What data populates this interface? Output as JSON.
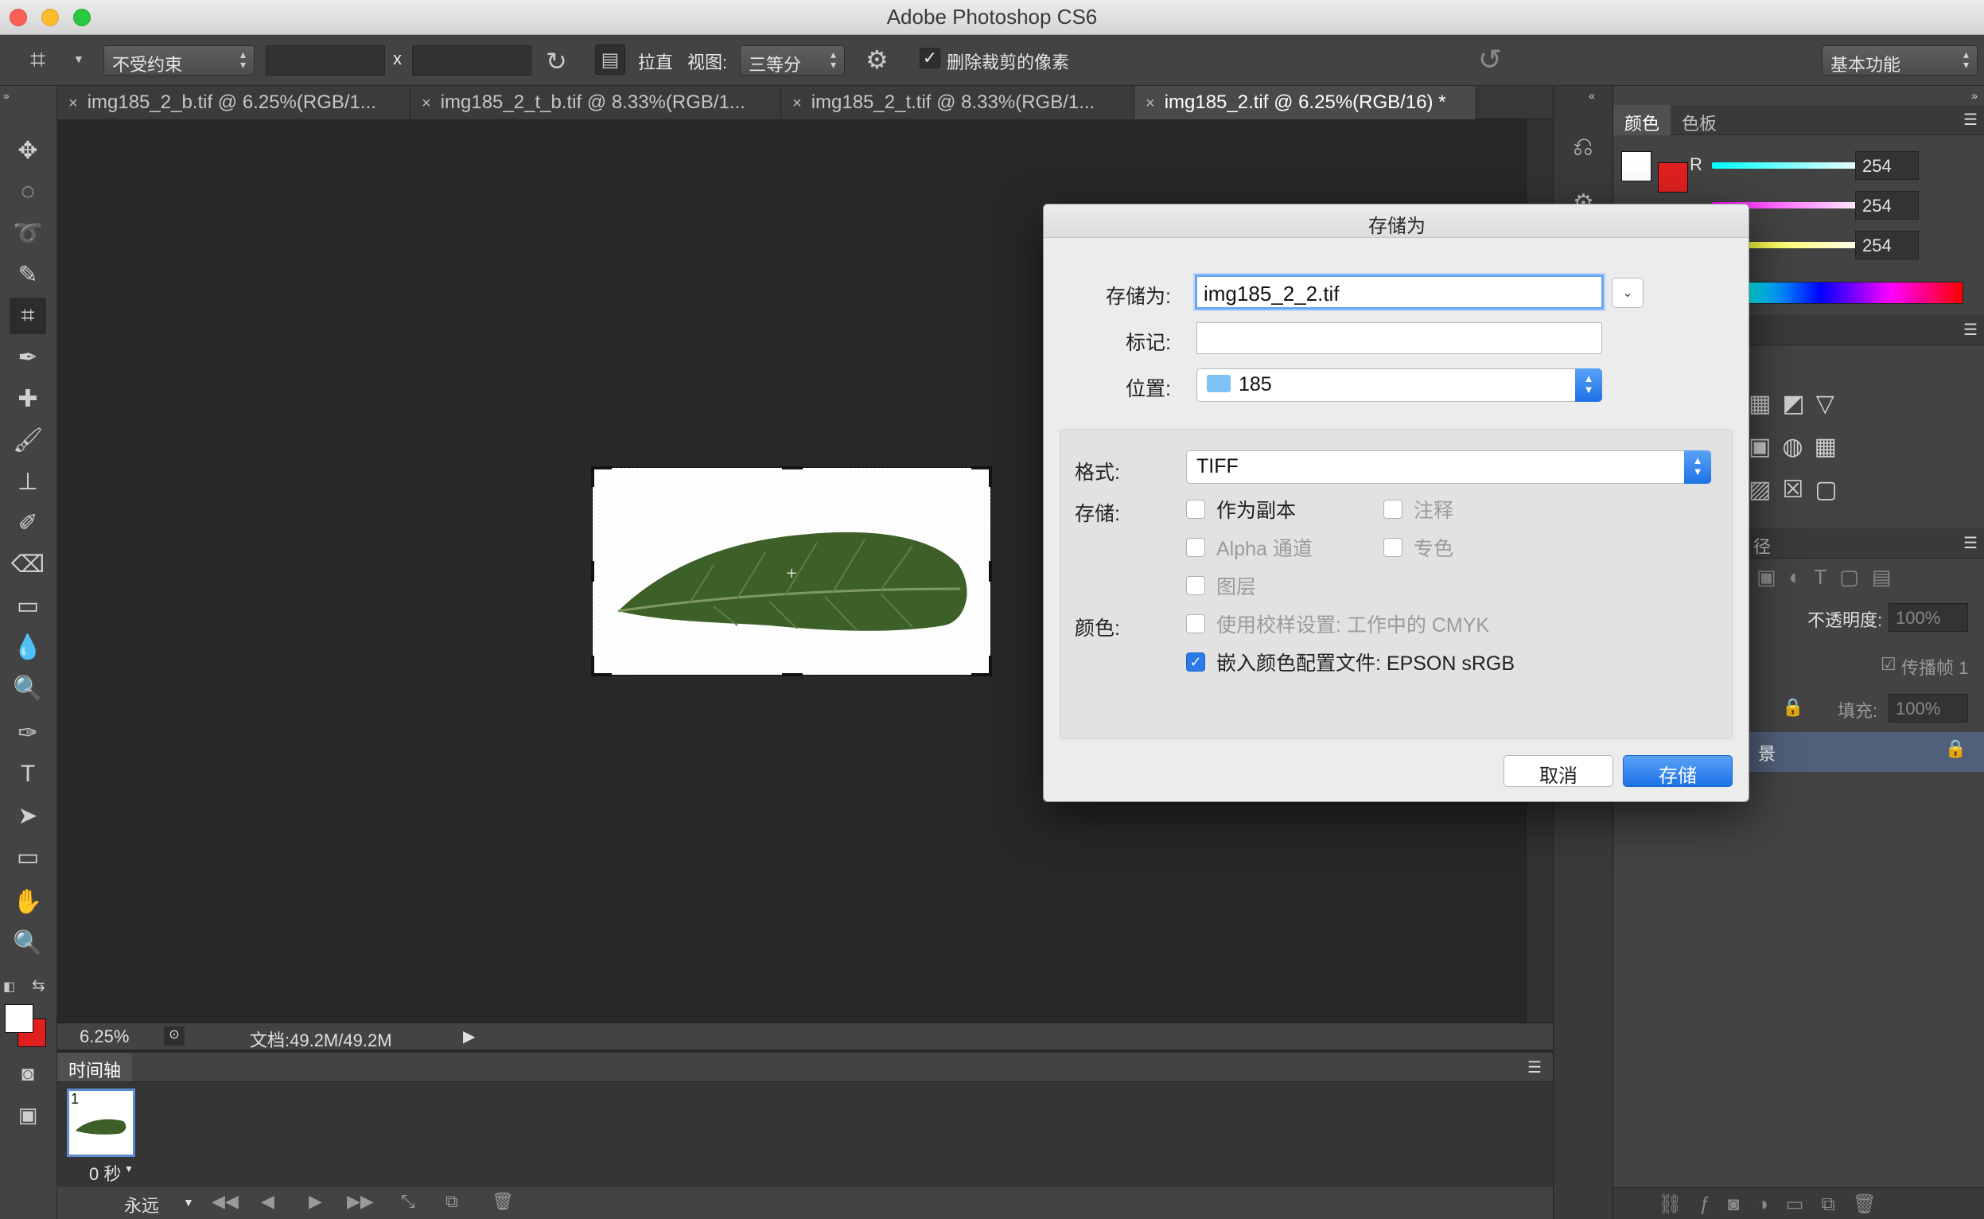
{
  "window": {
    "title": "Adobe Photoshop CS6"
  },
  "options_bar": {
    "ratio_select": "不受约束",
    "x_sep": "x",
    "straighten_label": "拉直",
    "view_label": "视图:",
    "view_select": "三等分",
    "delete_cropped_label": "删除裁剪的像素",
    "delete_cropped_checked": true,
    "workspace_select": "基本功能"
  },
  "tabs": [
    {
      "label": "img185_2_b.tif @ 6.25%(RGB/1...",
      "active": false
    },
    {
      "label": "img185_2_t_b.tif @ 8.33%(RGB/1...",
      "active": false
    },
    {
      "label": "img185_2_t.tif @ 8.33%(RGB/1...",
      "active": false
    },
    {
      "label": "img185_2.tif @ 6.25%(RGB/16) *",
      "active": true
    }
  ],
  "tab_close": "×",
  "status_bar": {
    "zoom": "6.25%",
    "doc_info": "文档:49.2M/49.2M"
  },
  "timeline": {
    "title": "时间轴",
    "frame_number": "1",
    "frame_delay": "0 秒",
    "loop": "永远"
  },
  "color_panel": {
    "tabs": [
      "颜色",
      "色板"
    ],
    "r_label": "R",
    "r": "254",
    "g": "254",
    "b": "254"
  },
  "layers_panel": {
    "tab_fragment": "径",
    "opacity_label": "不透明度:",
    "opacity": "100%",
    "propagate_label": "传播帧 1",
    "fill_label": "填充:",
    "fill": "100%",
    "layer_name_fragment": "景"
  },
  "dialog": {
    "title": "存储为",
    "save_as_label": "存储为:",
    "filename": "img185_2_2.tif",
    "tags_label": "标记:",
    "tags_value": "",
    "location_label": "位置:",
    "location": "185",
    "format_label": "格式:",
    "format": "TIFF",
    "save_label": "存储:",
    "color_label": "颜色:",
    "options": {
      "as_copy": {
        "label": "作为副本",
        "checked": false,
        "enabled": true
      },
      "notes": {
        "label": "注释",
        "checked": false,
        "enabled": false
      },
      "alpha": {
        "label": "Alpha 通道",
        "checked": false,
        "enabled": false
      },
      "spot": {
        "label": "专色",
        "checked": false,
        "enabled": false
      },
      "layers": {
        "label": "图层",
        "checked": false,
        "enabled": false
      },
      "proof": {
        "label": "使用校样设置: 工作中的 CMYK",
        "checked": false,
        "enabled": false
      },
      "icc": {
        "label": "嵌入颜色配置文件: EPSON  sRGB",
        "checked": true,
        "enabled": true
      }
    },
    "cancel": "取消",
    "save": "存储"
  },
  "colors": {
    "accent": "#2a7be8",
    "foreground": "#ffffff",
    "background": "#e02020"
  }
}
